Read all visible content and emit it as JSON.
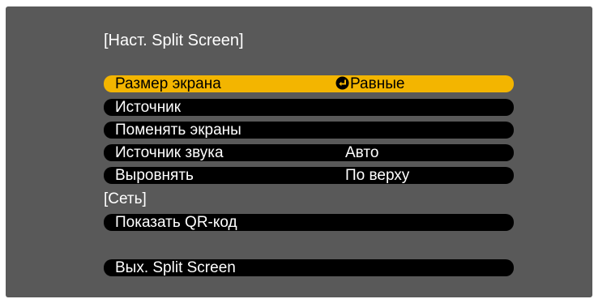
{
  "menu": {
    "title": "[Наст. Split Screen]",
    "selected_color": "#f3b500",
    "panel_color": "#595959",
    "items": [
      {
        "label": "Размер экрана",
        "value": "Равные",
        "selected": true,
        "has_enter_icon": true
      },
      {
        "label": "Источник",
        "value": ""
      },
      {
        "label": "Поменять экраны",
        "value": ""
      },
      {
        "label": "Источник звука",
        "value": "Авто"
      },
      {
        "label": "Выровнять",
        "value": "По верху"
      }
    ],
    "network_section": {
      "label": "[Сеть]",
      "items": [
        {
          "label": "Показать QR-код",
          "value": ""
        }
      ]
    },
    "exit": {
      "label": "Вых. Split Screen"
    }
  }
}
